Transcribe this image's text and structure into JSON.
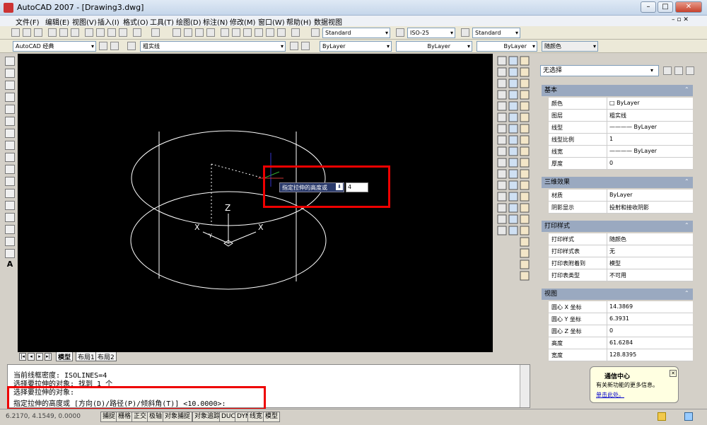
{
  "window": {
    "title": "AutoCAD 2007 - [Drawing3.dwg]",
    "min": "–",
    "max": "□",
    "close": "✕"
  },
  "menu": [
    "文件(F)",
    "编辑(E)",
    "视图(V)",
    "插入(I)",
    "格式(O)",
    "工具(T)",
    "绘图(D)",
    "标注(N)",
    "修改(M)",
    "窗口(W)",
    "帮助(H)",
    "数据视图"
  ],
  "toolbar": {
    "text_style": "Standard",
    "dim_style": "ISO-25",
    "table_style": "Standard",
    "workspace": "AutoCAD 经典",
    "layer": "粗实线",
    "color": "ByLayer",
    "linetype": "ByLayer",
    "lineweight": "ByLayer",
    "plotstyle": "随颜色"
  },
  "drawing": {
    "axis_z": "Z",
    "axis_x1": "X",
    "axis_x2": "X",
    "axis_y": "Y"
  },
  "dynamic_input": {
    "prompt": "指定拉伸的高度或",
    "value": "4"
  },
  "tabs": [
    "模型",
    "布局1",
    "布局2"
  ],
  "command": {
    "lines": [
      "当前线框密度:  ISOLINES=4",
      "选择要拉伸的对象: 找到 1 个",
      "选择要拉伸的对象:"
    ],
    "prompt": "指定拉伸的高度或 [方向(D)/路径(P)/倾斜角(T)] <10.0000>:"
  },
  "status": {
    "coords": "6.2170, 4.1549, 0.0000",
    "buttons": [
      "捕捉",
      "栅格",
      "正交",
      "极轴",
      "对象捕捉",
      "对象追踪",
      "DUCS",
      "DYN",
      "线宽",
      "模型"
    ]
  },
  "properties": {
    "selection": "无选择",
    "sections": [
      {
        "title": "基本",
        "rows": [
          {
            "k": "颜色",
            "v": "□ ByLayer"
          },
          {
            "k": "图层",
            "v": "粗实线"
          },
          {
            "k": "线型",
            "v": "———— ByLayer"
          },
          {
            "k": "线型比例",
            "v": "1"
          },
          {
            "k": "线宽",
            "v": "———— ByLayer"
          },
          {
            "k": "厚度",
            "v": "0"
          }
        ]
      },
      {
        "title": "三维效果",
        "rows": [
          {
            "k": "材质",
            "v": "ByLayer"
          },
          {
            "k": "阴影显示",
            "v": "投射和接收阴影"
          }
        ]
      },
      {
        "title": "打印样式",
        "rows": [
          {
            "k": "打印样式",
            "v": "随颜色"
          },
          {
            "k": "打印样式表",
            "v": "无"
          },
          {
            "k": "打印表附着到",
            "v": "模型"
          },
          {
            "k": "打印表类型",
            "v": "不可用"
          }
        ]
      },
      {
        "title": "视图",
        "rows": [
          {
            "k": "圆心 X 坐标",
            "v": "14.3869"
          },
          {
            "k": "圆心 Y 坐标",
            "v": "6.3931"
          },
          {
            "k": "圆心 Z 坐标",
            "v": "0"
          },
          {
            "k": "高度",
            "v": "61.6284"
          },
          {
            "k": "宽度",
            "v": "128.8395"
          }
        ]
      }
    ]
  },
  "balloon": {
    "title": "通信中心",
    "text": "有关新功能的更多信息。",
    "link": "单击此处。"
  }
}
